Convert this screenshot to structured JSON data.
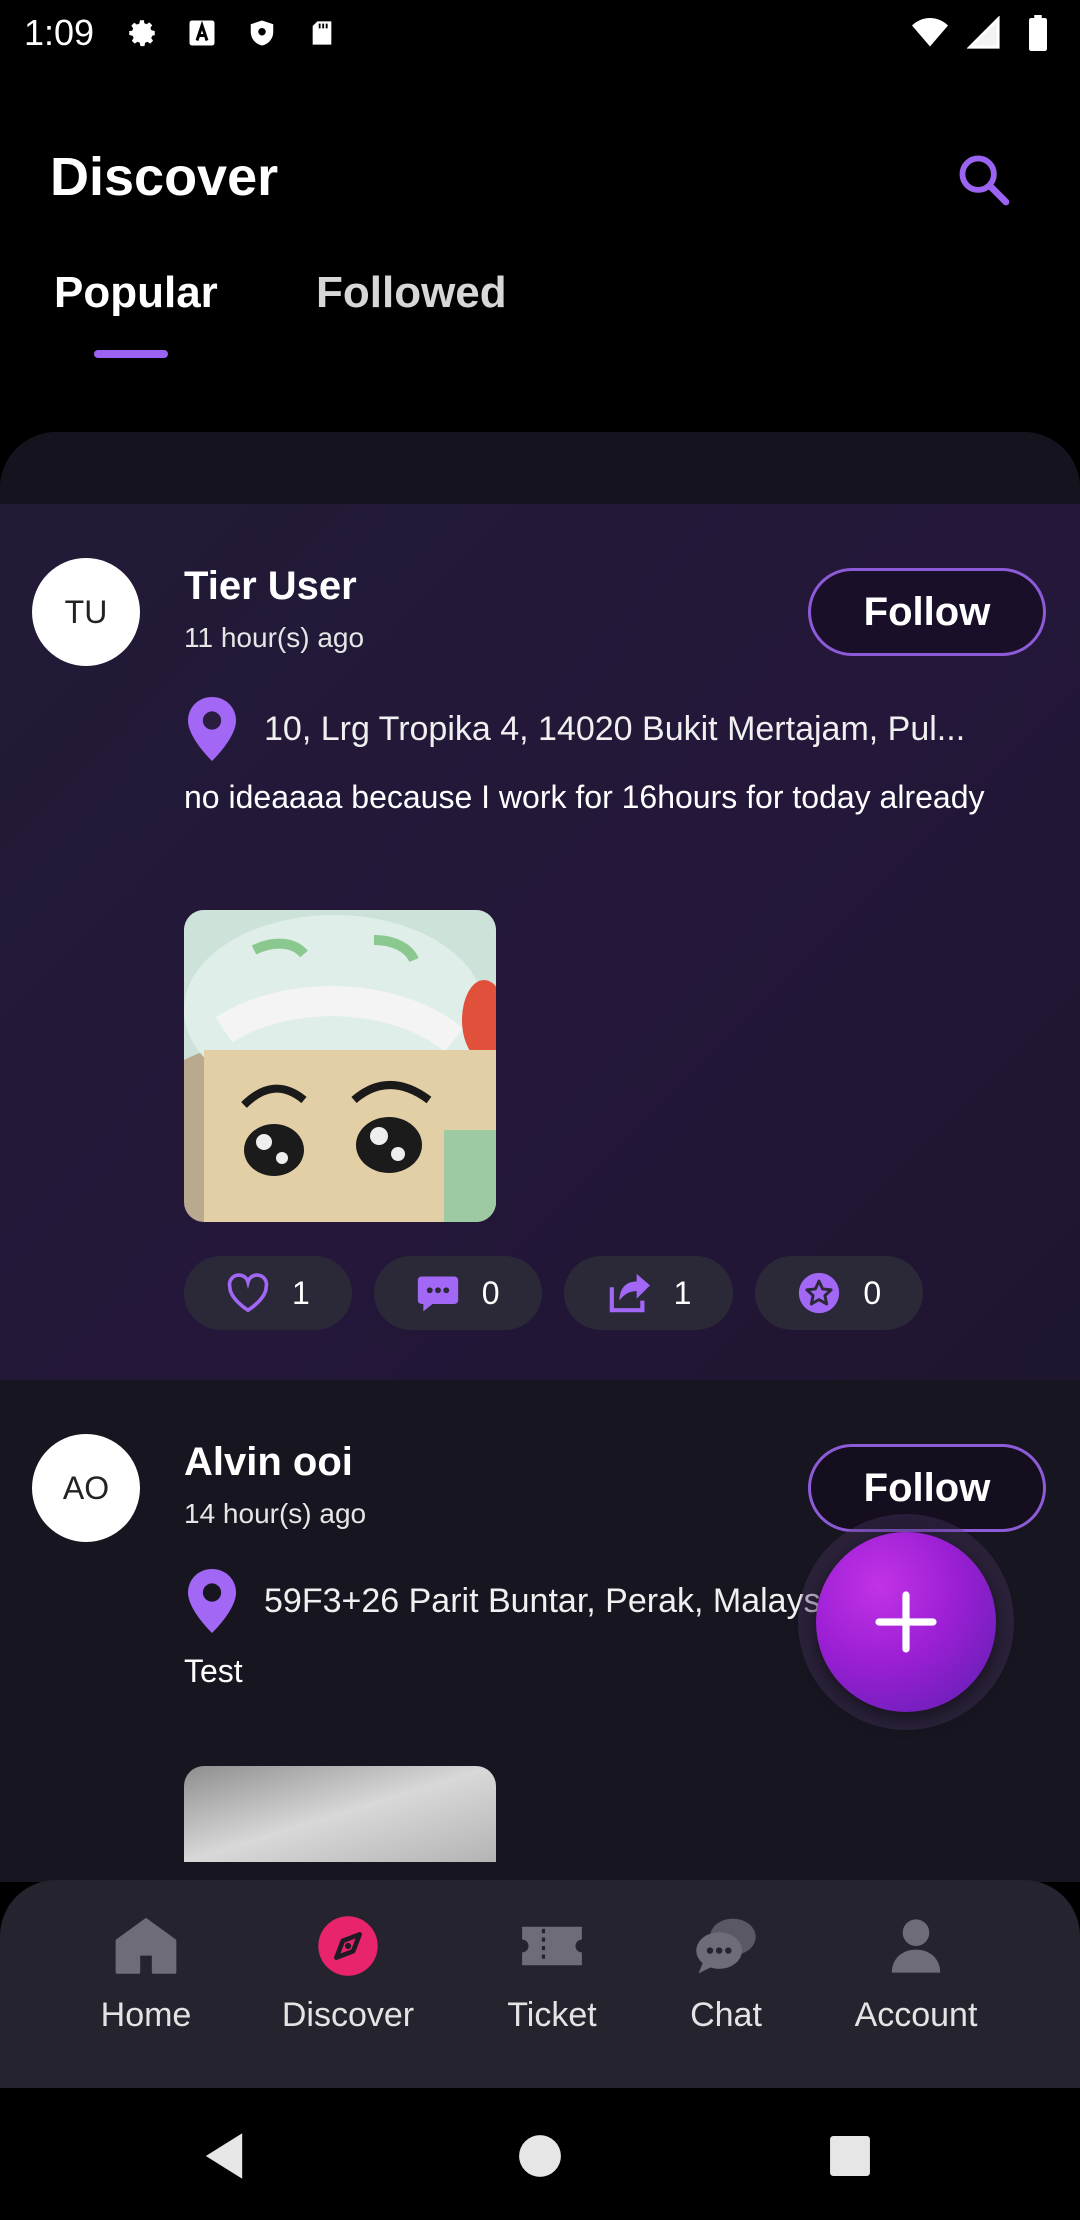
{
  "status_bar": {
    "time": "1:09",
    "left_icons": [
      "gear-icon",
      "a-box-icon",
      "shield-icon",
      "sd-card-icon"
    ],
    "right_icons": [
      "wifi-icon",
      "signal-icon",
      "battery-icon"
    ]
  },
  "header": {
    "title": "Discover",
    "search_icon": "search-icon"
  },
  "tabs": [
    {
      "label": "Popular",
      "active": true
    },
    {
      "label": "Followed",
      "active": false
    }
  ],
  "posts": [
    {
      "avatar_initials": "TU",
      "username": "Tier User",
      "time_ago": "11 hour(s) ago",
      "follow_label": "Follow",
      "location": "10, Lrg Tropika 4, 14020 Bukit Mertajam, Pul...",
      "text": "no ideaaaa because I work for 16hours for today already",
      "likes": "1",
      "comments": "0",
      "shares": "1",
      "stars": "0"
    },
    {
      "avatar_initials": "AO",
      "username": "Alvin ooi",
      "time_ago": "14 hour(s) ago",
      "follow_label": "Follow",
      "location": "59F3+26 Parit Buntar, Perak, Malaysia",
      "text": "Test"
    }
  ],
  "bottom_nav": [
    {
      "label": "Home",
      "icon": "home-icon",
      "active": false
    },
    {
      "label": "Discover",
      "icon": "compass-icon",
      "active": true
    },
    {
      "label": "Ticket",
      "icon": "ticket-icon",
      "active": false
    },
    {
      "label": "Chat",
      "icon": "chat-icon",
      "active": false
    },
    {
      "label": "Account",
      "icon": "person-icon",
      "active": false
    }
  ],
  "colors": {
    "accent": "#9b63f2",
    "active_nav": "#e8246c",
    "fab": "#a623d8"
  }
}
